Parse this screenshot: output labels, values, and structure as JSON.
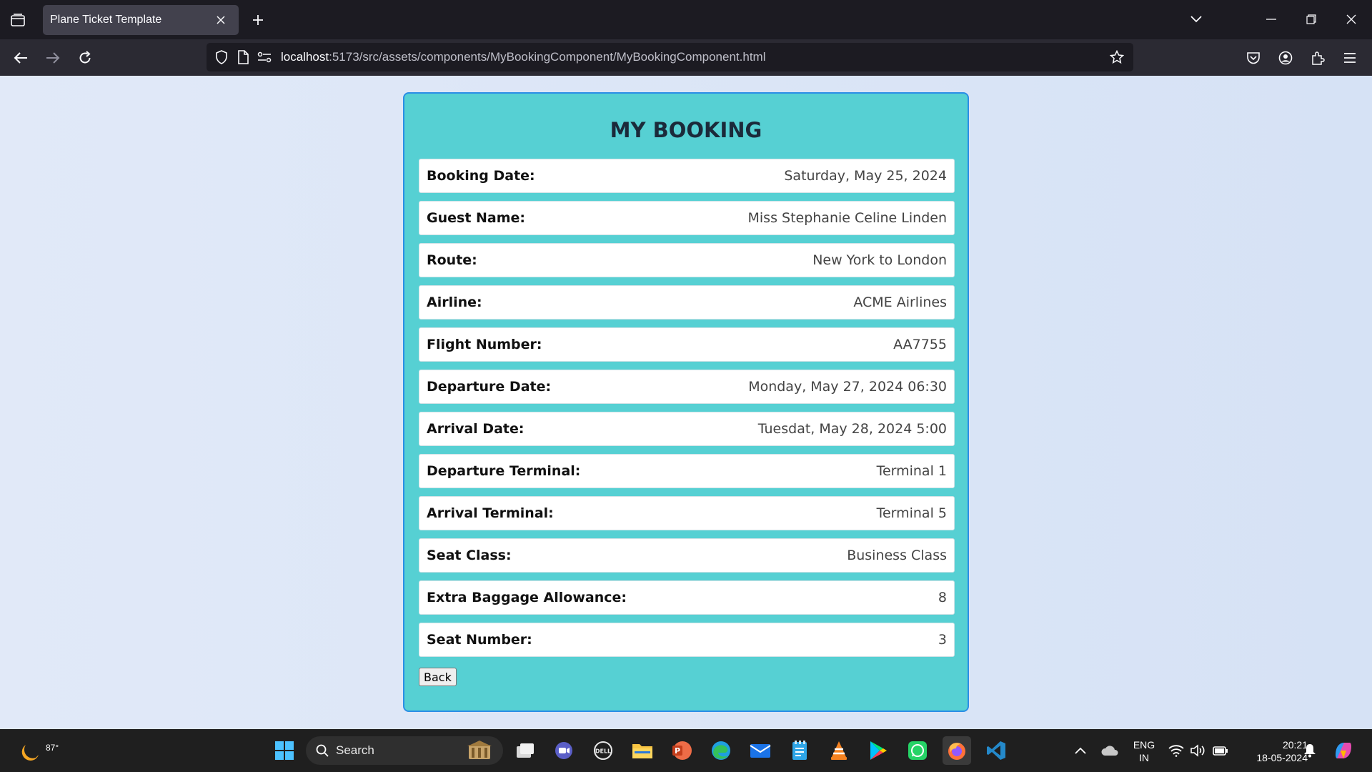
{
  "browser": {
    "tab_title": "Plane Ticket Template",
    "url_host": "localhost",
    "url_rest": ":5173/src/assets/components/MyBookingComponent/MyBookingComponent.html"
  },
  "page": {
    "title": "MY BOOKING",
    "rows": [
      {
        "label": "Booking Date:",
        "value": "Saturday, May 25, 2024"
      },
      {
        "label": "Guest Name:",
        "value": "Miss Stephanie Celine Linden"
      },
      {
        "label": "Route:",
        "value": "New York to London"
      },
      {
        "label": "Airline:",
        "value": "ACME Airlines"
      },
      {
        "label": "Flight Number:",
        "value": "AA7755"
      },
      {
        "label": "Departure Date:",
        "value": "Monday, May 27, 2024 06:30"
      },
      {
        "label": "Arrival Date:",
        "value": "Tuesdat, May 28, 2024 5:00"
      },
      {
        "label": "Departure Terminal:",
        "value": "Terminal 1"
      },
      {
        "label": "Arrival Terminal:",
        "value": "Terminal 5"
      },
      {
        "label": "Seat Class:",
        "value": "Business Class"
      },
      {
        "label": "Extra Baggage Allowance:",
        "value": "8"
      },
      {
        "label": "Seat Number:",
        "value": "3"
      }
    ],
    "back_label": "Back"
  },
  "taskbar": {
    "temperature": "87°",
    "search_label": "Search",
    "language_line1": "ENG",
    "language_line2": "IN",
    "time": "20:21",
    "date": "18-05-2024"
  },
  "colors": {
    "card_bg": "#56d0d3",
    "card_border": "#2b8ee6",
    "page_bg": "#dfe8f7"
  }
}
